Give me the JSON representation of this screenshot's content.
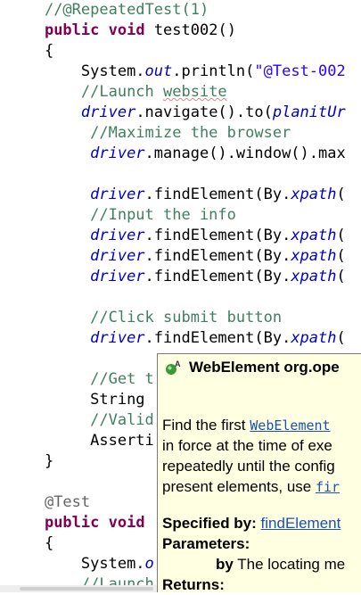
{
  "editor": {
    "lines": [
      {
        "indent": "    ",
        "segments": [
          {
            "t": "//@RepeatedTest(1)",
            "c": "cm"
          }
        ]
      },
      {
        "indent": "    ",
        "segments": [
          {
            "t": "public",
            "c": "kw"
          },
          {
            "t": " ",
            "c": ""
          },
          {
            "t": "void",
            "c": "kw"
          },
          {
            "t": " test002()",
            "c": ""
          }
        ]
      },
      {
        "indent": "    ",
        "segments": [
          {
            "t": "{",
            "c": ""
          }
        ]
      },
      {
        "indent": "        ",
        "segments": [
          {
            "t": "System.",
            "c": ""
          },
          {
            "t": "out",
            "c": "fld"
          },
          {
            "t": ".println(",
            "c": ""
          },
          {
            "t": "\"@Test-002",
            "c": "st"
          }
        ]
      },
      {
        "indent": "        ",
        "segments": [
          {
            "t": "//Launch ",
            "c": "cm"
          },
          {
            "t": "website",
            "c": "cm squig"
          }
        ]
      },
      {
        "indent": "        ",
        "segments": [
          {
            "t": "driver",
            "c": "fld"
          },
          {
            "t": ".navigate().to(",
            "c": ""
          },
          {
            "t": "planitUr",
            "c": "fld"
          }
        ]
      },
      {
        "indent": "         ",
        "segments": [
          {
            "t": "//Maximize the browser",
            "c": "cm"
          }
        ]
      },
      {
        "indent": "         ",
        "segments": [
          {
            "t": "driver",
            "c": "fld"
          },
          {
            "t": ".manage().window().max",
            "c": ""
          }
        ]
      },
      {
        "indent": "",
        "segments": []
      },
      {
        "indent": "         ",
        "segments": [
          {
            "t": "driver",
            "c": "fld"
          },
          {
            "t": ".findElement(By.",
            "c": ""
          },
          {
            "t": "xpath",
            "c": "fld"
          },
          {
            "t": "(",
            "c": ""
          }
        ]
      },
      {
        "indent": "         ",
        "segments": [
          {
            "t": "//Input the info",
            "c": "cm"
          }
        ]
      },
      {
        "indent": "         ",
        "segments": [
          {
            "t": "driver",
            "c": "fld"
          },
          {
            "t": ".findElement(By.",
            "c": ""
          },
          {
            "t": "xpath",
            "c": "fld"
          },
          {
            "t": "(",
            "c": ""
          }
        ]
      },
      {
        "indent": "         ",
        "segments": [
          {
            "t": "driver",
            "c": "fld"
          },
          {
            "t": ".findElement(By.",
            "c": ""
          },
          {
            "t": "xpath",
            "c": "fld"
          },
          {
            "t": "(",
            "c": ""
          }
        ]
      },
      {
        "indent": "         ",
        "segments": [
          {
            "t": "driver",
            "c": "fld"
          },
          {
            "t": ".findElement(By.",
            "c": ""
          },
          {
            "t": "xpath",
            "c": "fld"
          },
          {
            "t": "(",
            "c": ""
          }
        ]
      },
      {
        "indent": "",
        "segments": []
      },
      {
        "indent": "         ",
        "segments": [
          {
            "t": "//Click submit button",
            "c": "cm"
          }
        ]
      },
      {
        "indent": "         ",
        "segments": [
          {
            "t": "driver",
            "c": "fld"
          },
          {
            "t": ".findElement(By.",
            "c": ""
          },
          {
            "t": "xpath",
            "c": "fld"
          },
          {
            "t": "(",
            "c": ""
          }
        ]
      },
      {
        "indent": "",
        "segments": []
      },
      {
        "indent": "         ",
        "segments": [
          {
            "t": "//Get t",
            "c": "cm"
          }
        ]
      },
      {
        "indent": "         ",
        "segments": [
          {
            "t": "String",
            "c": ""
          }
        ]
      },
      {
        "indent": "         ",
        "segments": [
          {
            "t": "//Valid",
            "c": "cm"
          }
        ]
      },
      {
        "indent": "         ",
        "segments": [
          {
            "t": "Asserti",
            "c": ""
          }
        ]
      },
      {
        "indent": "    ",
        "segments": [
          {
            "t": "}",
            "c": ""
          }
        ]
      },
      {
        "indent": "",
        "segments": []
      },
      {
        "indent": "    ",
        "segments": [
          {
            "t": "@Test",
            "c": "ann"
          }
        ]
      },
      {
        "indent": "    ",
        "segments": [
          {
            "t": "public",
            "c": "kw"
          },
          {
            "t": " ",
            "c": ""
          },
          {
            "t": "void",
            "c": "kw"
          }
        ]
      },
      {
        "indent": "    ",
        "segments": [
          {
            "t": "{",
            "c": ""
          }
        ]
      },
      {
        "indent": "        ",
        "segments": [
          {
            "t": "System.",
            "c": ""
          },
          {
            "t": "o",
            "c": "fld"
          }
        ]
      },
      {
        "indent": "        ",
        "segments": [
          {
            "t": "//Launch",
            "c": "cm"
          }
        ]
      }
    ]
  },
  "popup": {
    "title": "WebElement org.ope",
    "desc_line1_pre": "Find the first ",
    "desc_line1_link": "WebElement",
    "desc_line2": "in force at the time of exe",
    "desc_line3": "repeatedly until the config",
    "desc_line4_pre": "present elements, use ",
    "desc_line4_link": "fir",
    "specified_label": "Specified by:",
    "specified_link": "findElement",
    "parameters_label": "Parameters:",
    "param_name": "by",
    "param_desc": " The locating me",
    "returns_label": "Returns:"
  }
}
